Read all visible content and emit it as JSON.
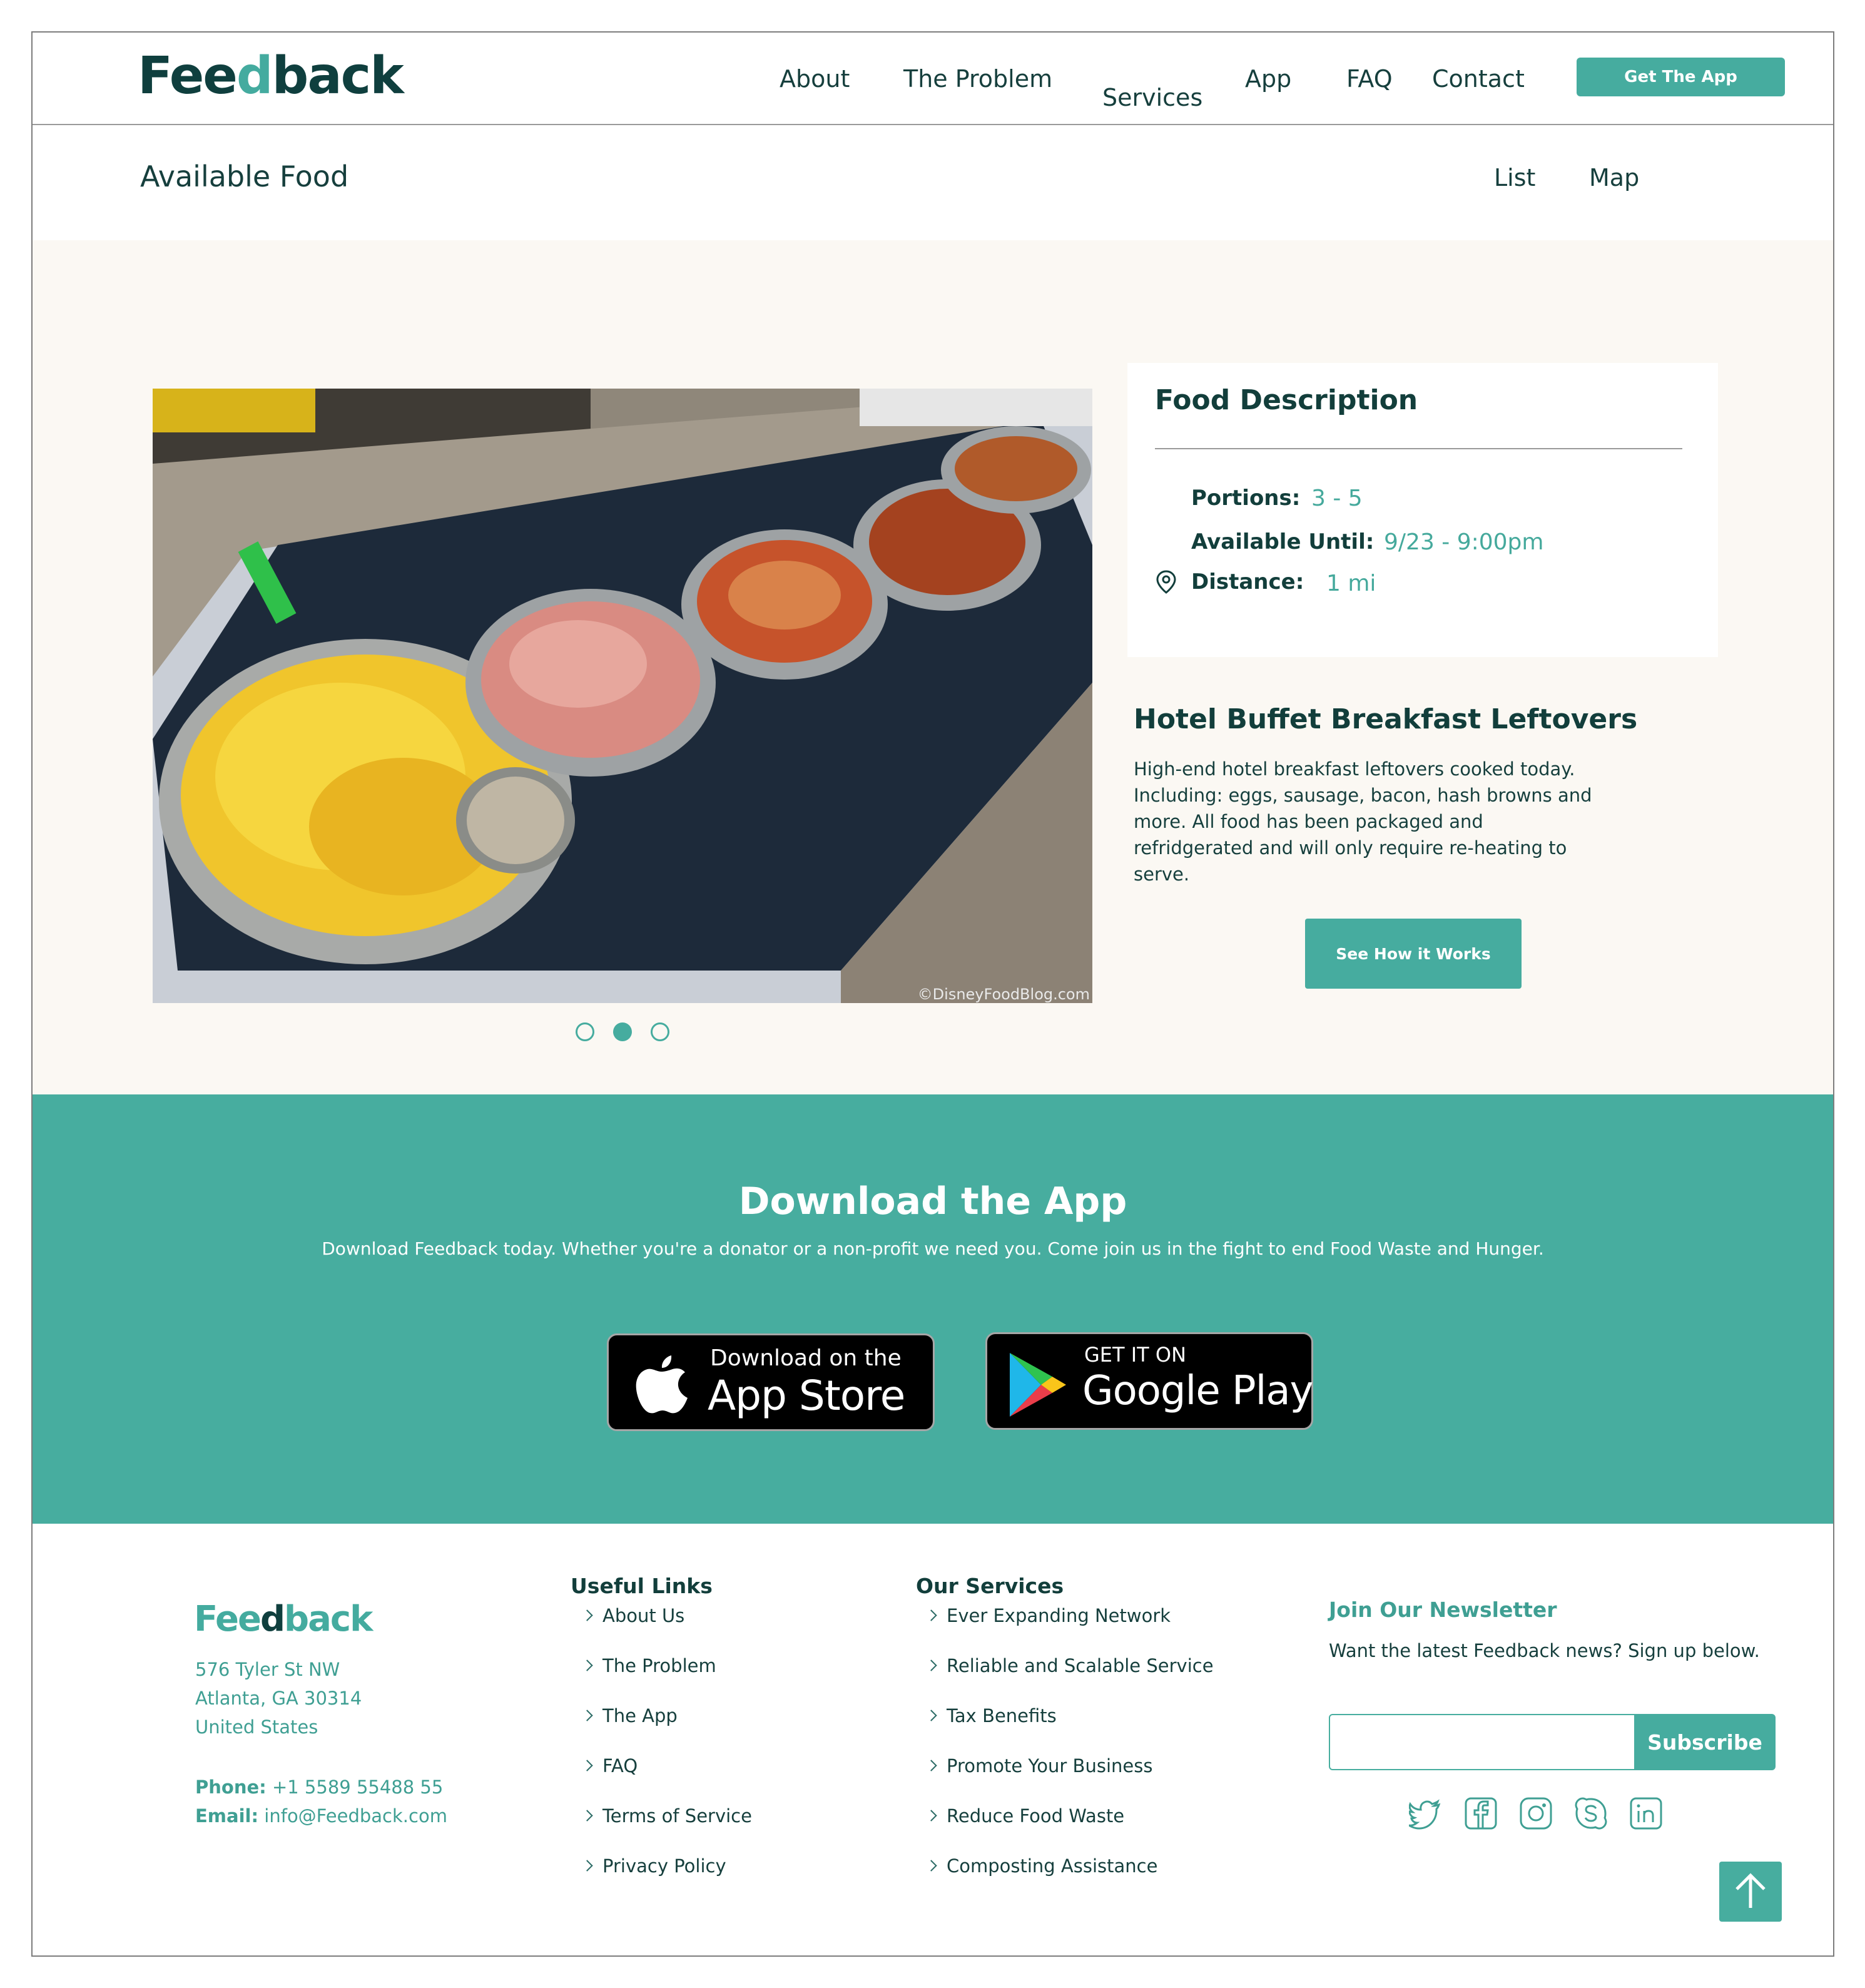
{
  "header": {
    "logo": {
      "pre": "Fee",
      "accent": "d",
      "post": "back"
    },
    "nav": [
      "About",
      "The Problem",
      "Services",
      "App",
      "FAQ",
      "Contact"
    ],
    "cta": "Get The App"
  },
  "subheader": {
    "title": "Available Food",
    "views": [
      "List",
      "Map"
    ]
  },
  "hero": {
    "image_credit": "©DisneyFoodBlog.com",
    "card": {
      "title": "Food Description",
      "portions_label": "Portions:",
      "portions_value": "3 - 5",
      "until_label": "Available Until:",
      "until_value": "9/23 - 9:00pm",
      "distance_label": "Distance:",
      "distance_value": "1 mi"
    },
    "food_title": "Hotel Buffet Breakfast Leftovers",
    "food_desc": [
      "High-end hotel breakfast leftovers cooked today.",
      "Including: eggs, sausage, bacon, hash browns and",
      "more. All food has been packaged and",
      "refridgerated and will only require re-heating to",
      "serve."
    ],
    "button": "See How it Works",
    "carousel": {
      "count": 3,
      "active": 2
    }
  },
  "download": {
    "title": "Download the App",
    "subtitle": "Download Feedback today. Whether you're a donator or a non-profit we need you. Come join us in the fight to end Food Waste and Hunger.",
    "appstore_small": "Download on the",
    "appstore_big": "App Store",
    "googleplay_small": "GET IT ON",
    "googleplay_big": "Google Play"
  },
  "footer": {
    "logo": {
      "pre": "Fee",
      "accent": "d",
      "post": "back"
    },
    "address": [
      "576 Tyler St NW",
      "Atlanta, GA 30314",
      "United States"
    ],
    "phone_label": "Phone:",
    "phone": "+1 5589 55488 55",
    "email_label": "Email:",
    "email": "info@Feedback.com",
    "useful_title": "Useful Links",
    "useful_links": [
      "About Us",
      "The Problem",
      "The App",
      "FAQ",
      "Terms of Service",
      "Privacy Policy"
    ],
    "services_title": "Our Services",
    "services": [
      "Ever Expanding Network",
      "Reliable and Scalable Service",
      "Tax Benefits",
      "Promote Your Business",
      "Reduce Food Waste",
      "Composting Assistance"
    ],
    "newsletter_title": "Join Our Newsletter",
    "newsletter_text": "Want the latest Feedback news? Sign up below.",
    "subscribe": "Subscribe",
    "social_icons": [
      "twitter-icon",
      "facebook-icon",
      "instagram-icon",
      "skype-icon",
      "linkedin-icon"
    ]
  },
  "colors": {
    "teal": "#47ad9f",
    "dark": "#123e3b",
    "cream": "#fbf8f3"
  }
}
